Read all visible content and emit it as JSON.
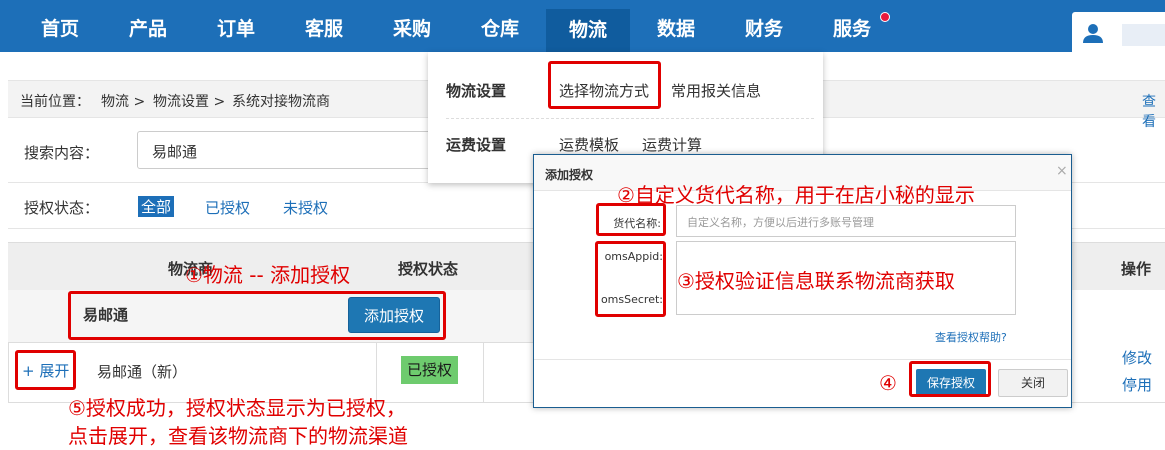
{
  "nav": {
    "items": [
      "首页",
      "产品",
      "订单",
      "客服",
      "采购",
      "仓库",
      "物流",
      "数据",
      "财务",
      "服务"
    ],
    "active": "物流"
  },
  "breadcrumb": {
    "prefix": "当前位置：",
    "path1": "物流 >",
    "path2": "物流设置 >",
    "current": "系统对接物流商",
    "right_link": "查看"
  },
  "search": {
    "label": "搜索内容：",
    "value": "易邮通"
  },
  "auth_filter": {
    "label": "授权状态：",
    "options": [
      "全部",
      "已授权",
      "未授权"
    ],
    "selected": "全部"
  },
  "table": {
    "headers": {
      "provider": "物流商",
      "status": "授权状态",
      "action": "操作"
    },
    "group": {
      "name": "易邮通",
      "button": "添加授权"
    },
    "rows": [
      {
        "expand": "+ 展开",
        "name": "易邮通（新）",
        "status": "已授权",
        "actions": [
          "修改",
          "停用"
        ]
      }
    ]
  },
  "dropdown": {
    "sections": [
      {
        "title": "物流设置",
        "links": [
          "选择物流方式",
          "常用报关信息"
        ]
      },
      {
        "title": "运费设置",
        "links": [
          "运费模板",
          "运费计算"
        ]
      }
    ]
  },
  "modal": {
    "title": "添加授权",
    "close": "×",
    "fields": {
      "alias_label": "货代名称:",
      "alias_placeholder": "自定义名称，方便以后进行多账号管理",
      "appid_label": "omsAppid:",
      "secret_label": "omsSecret:"
    },
    "help": "查看授权帮助?",
    "save": "保存授权",
    "cancel": "关闭"
  },
  "annotations": {
    "a1": "①物流 -- 添加授权",
    "a2": "②自定义货代名称，用于在店小秘的显示",
    "a3": "③授权验证信息联系物流商获取",
    "a4": "④",
    "a5_line1": "⑤授权成功，授权状态显示为已授权，",
    "a5_line2": "点击展开，查看该物流商下的物流渠道"
  },
  "colors": {
    "primary": "#1d6fb8",
    "nav_active": "#105c9e",
    "annotation": "#e00000",
    "status_ok": "#6ecb6e"
  }
}
